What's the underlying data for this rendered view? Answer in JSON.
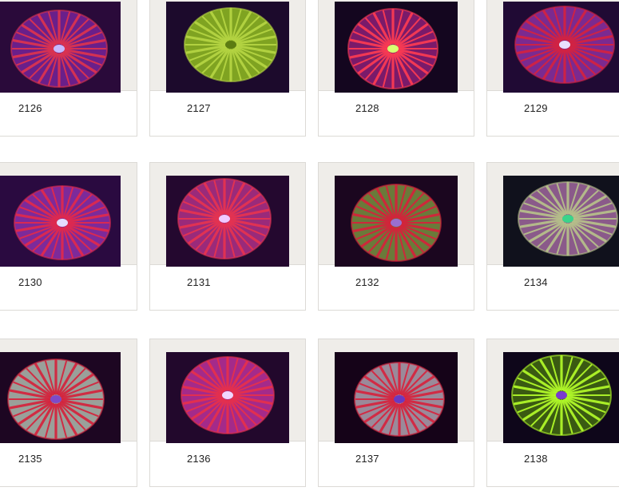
{
  "gallery": {
    "items": [
      {
        "id": "2126",
        "image": "coral-photo",
        "palette": {
          "bg": "#2a0a3a",
          "base": "#6a1f8a",
          "stripe": "#e0344e",
          "center": "#c7b8ff"
        }
      },
      {
        "id": "2127",
        "image": "coral-photo",
        "palette": {
          "bg": "#1c0a2c",
          "base": "#7fa321",
          "stripe": "#b7d644",
          "center": "#5c7c12"
        }
      },
      {
        "id": "2128",
        "image": "coral-photo",
        "palette": {
          "bg": "#14061f",
          "base": "#7a1a6a",
          "stripe": "#ff3c52",
          "center": "#d8ff70"
        }
      },
      {
        "id": "2129",
        "image": "coral-photo",
        "palette": {
          "bg": "#200a34",
          "base": "#7b2a90",
          "stripe": "#d6223f",
          "center": "#e9e0ff"
        }
      },
      {
        "id": "2130",
        "image": "coral-photo",
        "palette": {
          "bg": "#2a0a40",
          "base": "#7d2a9a",
          "stripe": "#e3294b",
          "center": "#e5dcff"
        }
      },
      {
        "id": "2131",
        "image": "coral-photo",
        "palette": {
          "bg": "#24082f",
          "base": "#9a2a7a",
          "stripe": "#e8334f",
          "center": "#f0c9ff"
        }
      },
      {
        "id": "2132",
        "image": "coral-photo",
        "palette": {
          "bg": "#1b061f",
          "base": "#6a7a3a",
          "stripe": "#d8203b",
          "center": "#9a6fd0"
        }
      },
      {
        "id": "2134",
        "image": "coral-photo",
        "palette": {
          "bg": "#10111c",
          "base": "#8a5a8a",
          "stripe": "#b8c48a",
          "center": "#3ad48a"
        }
      },
      {
        "id": "2135",
        "image": "coral-photo",
        "palette": {
          "bg": "#1d0622",
          "base": "#9aa09a",
          "stripe": "#d6203a",
          "center": "#7e4ac8"
        }
      },
      {
        "id": "2136",
        "image": "coral-photo",
        "palette": {
          "bg": "#22082c",
          "base": "#a42a8a",
          "stripe": "#e8304a",
          "center": "#f1d7ff"
        }
      },
      {
        "id": "2137",
        "image": "coral-photo",
        "palette": {
          "bg": "#150318",
          "base": "#9a8a9a",
          "stripe": "#d8213c",
          "center": "#6a38c2"
        }
      },
      {
        "id": "2138",
        "image": "coral-photo",
        "palette": {
          "bg": "#0e061a",
          "base": "#3a5a12",
          "stripe": "#b6ff2a",
          "center": "#7a3ad0"
        }
      }
    ]
  }
}
